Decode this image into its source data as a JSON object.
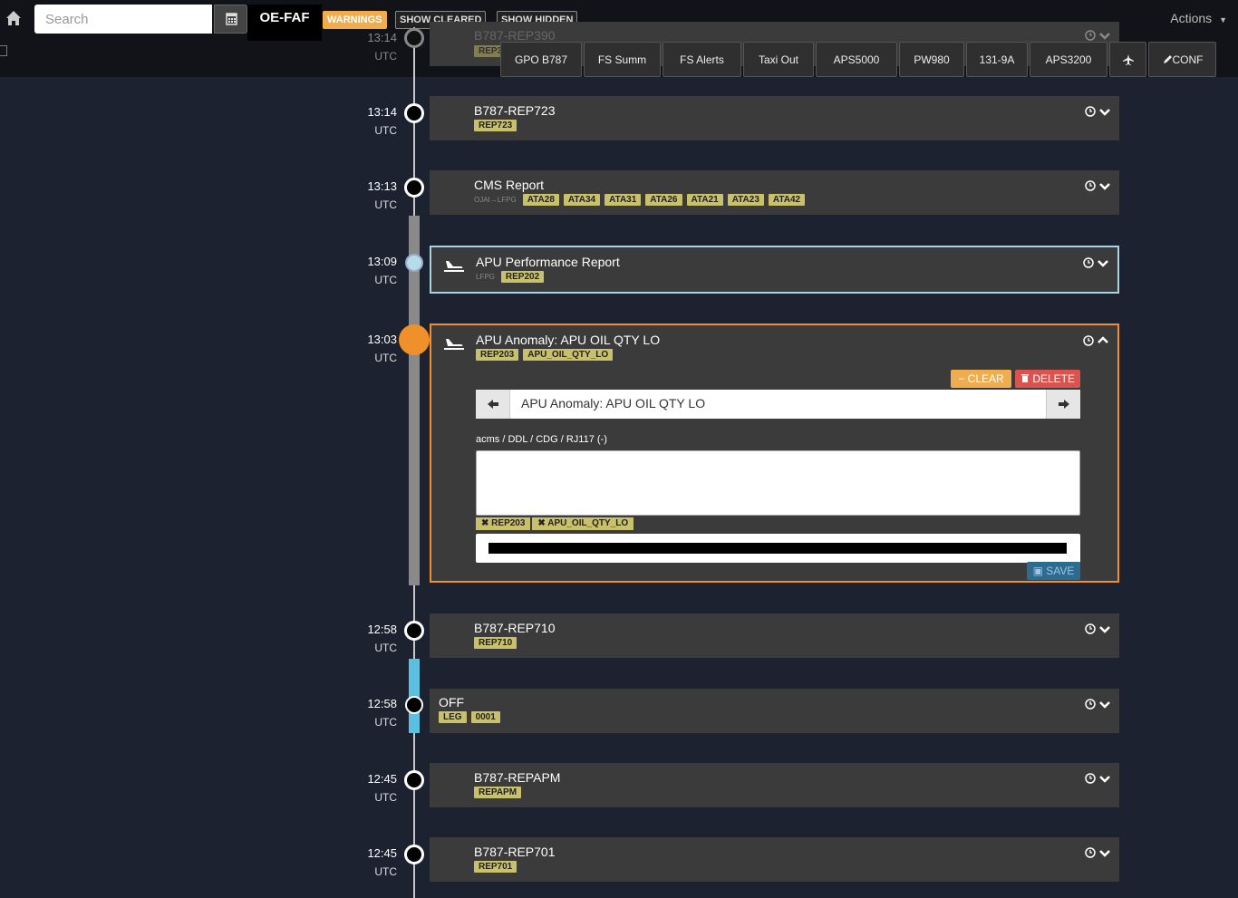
{
  "topbar": {
    "search_placeholder": "Search",
    "registration": "OE-FAF",
    "warnings_label": "WARNINGS",
    "show_cleared_label": "SHOW CLEARED",
    "show_hidden_label": "SHOW HIDDEN",
    "actions_label": "Actions",
    "accent_warning": "#f0ad4e"
  },
  "toolbar": {
    "buttons": [
      "GPO B787",
      "FS Summ",
      "FS Alerts",
      "Taxi Out",
      "APS5000",
      "PW980",
      "131-9A",
      "APS3200",
      "",
      "CONF"
    ]
  },
  "utc_label": "UTC",
  "events": [
    {
      "time": "13:14",
      "title": "B787-REP390",
      "tags": [
        "REP390"
      ],
      "state": "partial"
    },
    {
      "time": "13:14",
      "title": "B787-REP723",
      "tags": [
        "REP723"
      ]
    },
    {
      "time": "13:13",
      "title": "CMS Report",
      "subtext": "OJAI→LFPG",
      "tags": [
        "ATA28",
        "ATA34",
        "ATA31",
        "ATA26",
        "ATA21",
        "ATA23",
        "ATA42"
      ]
    },
    {
      "time": "13:09",
      "title": "APU Performance Report",
      "subtext": "LFPG",
      "tags": [
        "REP202"
      ],
      "state": "selected",
      "border_color": "#a9d4e6"
    },
    {
      "time": "13:03",
      "title": "APU Anomaly: APU OIL QTY LO",
      "tags": [
        "REP203",
        "APU_OIL_QTY_LO"
      ],
      "state": "expanded",
      "border_color": "#f0902a"
    },
    {
      "time": "12:58",
      "title": "B787-REP710",
      "tags": [
        "REP710"
      ]
    },
    {
      "time": "12:58",
      "title": "OFF",
      "tags": [
        "LEG",
        "0001"
      ]
    },
    {
      "time": "12:45",
      "title": "B787-REPAPM",
      "tags": [
        "REPAPM"
      ]
    },
    {
      "time": "12:45",
      "title": "B787-REP701",
      "tags": [
        "REP701"
      ]
    }
  ],
  "expanded": {
    "clear_label": "CLEAR",
    "delete_label": "DELETE",
    "nav_title": "APU Anomaly:  APU OIL QTY LO",
    "path": "acms / DDL / CDG / RJ117 (-)",
    "removable_tags": [
      "REP203",
      "APU_OIL_QTY_LO"
    ],
    "save_label": "SAVE"
  }
}
